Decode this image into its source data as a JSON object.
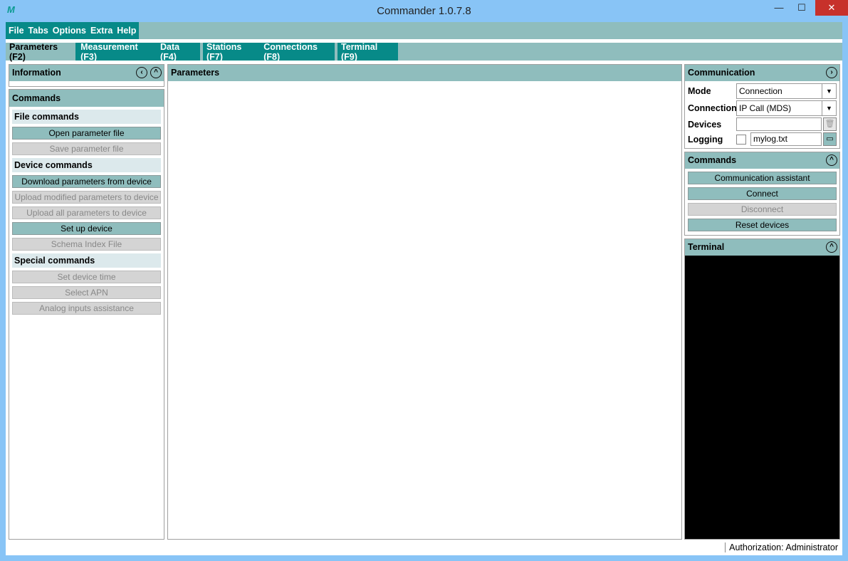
{
  "window": {
    "title": "Commander 1.0.7.8",
    "logo": "M",
    "minimize": "—",
    "maximize": "☐",
    "close": "✕"
  },
  "menu": [
    "File",
    "Tabs",
    "Options",
    "Extra",
    "Help"
  ],
  "tabs": {
    "group1": [
      "Parameters (F2)",
      "Measurement (F3)",
      "Data (F4)"
    ],
    "group2": [
      "Stations (F7)",
      "Connections (F8)"
    ],
    "group3": [
      "Terminal (F9)"
    ]
  },
  "left": {
    "information": "Information",
    "commands": "Commands",
    "file_commands": "File commands",
    "open_param": "Open parameter file",
    "save_param": "Save parameter file",
    "device_commands": "Device commands",
    "download": "Download parameters from device",
    "upload_modified": "Upload modified parameters to device",
    "upload_all": "Upload all parameters to device",
    "setup": "Set up device",
    "schema": "Schema Index File",
    "special_commands": "Special commands",
    "set_time": "Set device time",
    "select_apn": "Select APN",
    "analog": "Analog inputs assistance"
  },
  "center": {
    "title": "Parameters"
  },
  "right": {
    "communication": "Communication",
    "mode_label": "Mode",
    "mode_value": "Connection",
    "connection_label": "Connection",
    "connection_value": "IP Call (MDS)",
    "devices_label": "Devices",
    "devices_value": "",
    "logging_label": "Logging",
    "logging_file": "mylog.txt",
    "commands": "Commands",
    "assistant": "Communication assistant",
    "connect": "Connect",
    "disconnect": "Disconnect",
    "reset": "Reset devices",
    "terminal": "Terminal"
  },
  "status": {
    "authorization": "Authorization: Administrator"
  }
}
